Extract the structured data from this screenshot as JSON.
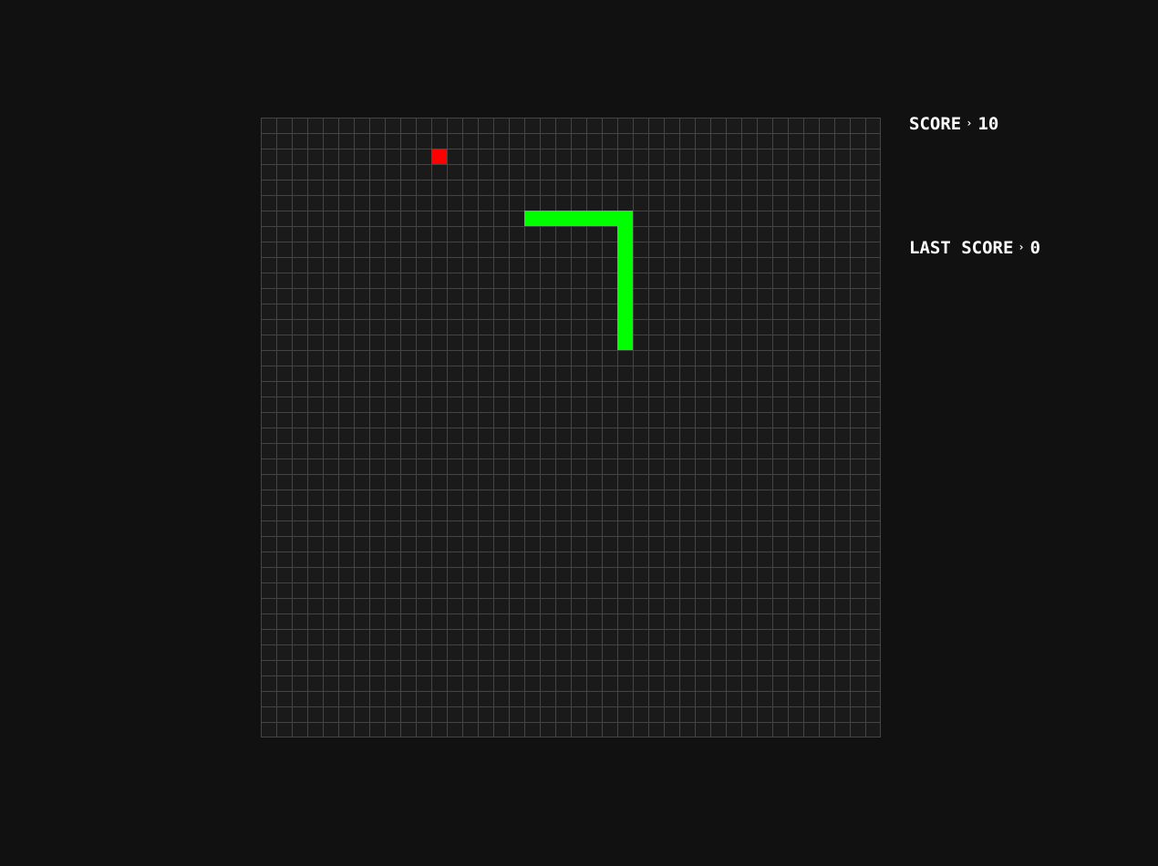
{
  "game": {
    "grid": {
      "cols": 40,
      "rows": 40
    },
    "snake": {
      "color": "#00ff00",
      "cells": [
        [
          23,
          14
        ],
        [
          23,
          13
        ],
        [
          23,
          12
        ],
        [
          23,
          11
        ],
        [
          23,
          10
        ],
        [
          23,
          9
        ],
        [
          23,
          8
        ],
        [
          23,
          7
        ],
        [
          23,
          6
        ],
        [
          22,
          6
        ],
        [
          21,
          6
        ],
        [
          20,
          6
        ],
        [
          19,
          6
        ],
        [
          18,
          6
        ],
        [
          17,
          6
        ]
      ]
    },
    "food": {
      "color": "#ff0000",
      "cell": [
        11,
        2
      ]
    },
    "colors": {
      "background": "#111111",
      "board": "#1a1a1a",
      "grid_line": "#454545"
    }
  },
  "hud": {
    "score_label": "SCORE",
    "score_sep": "›",
    "score_value": "10",
    "last_score_label": "LAST SCORE",
    "last_score_sep": "›",
    "last_score_value": "0"
  }
}
